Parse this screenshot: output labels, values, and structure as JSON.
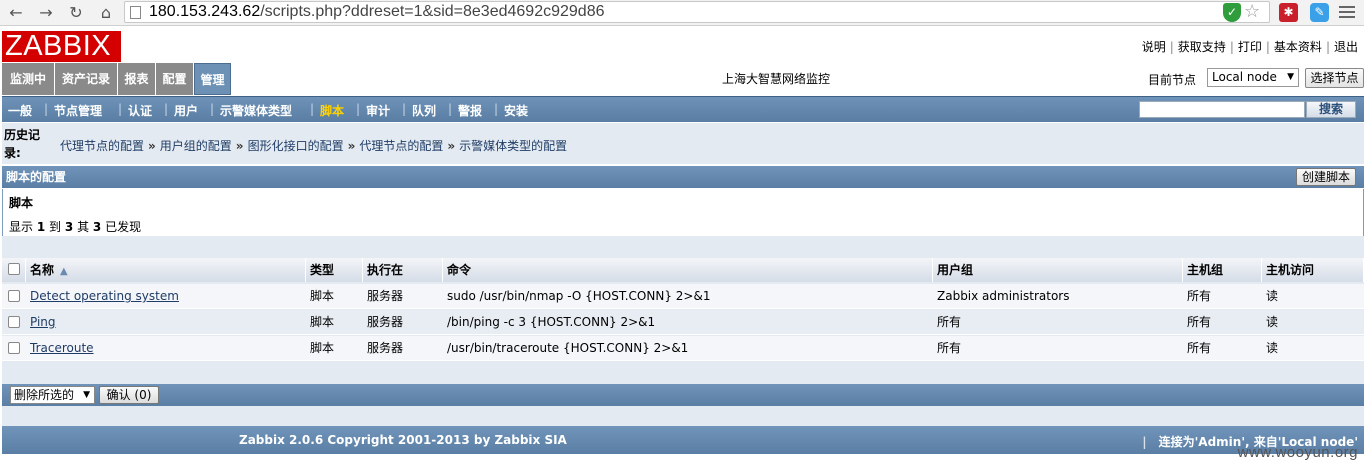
{
  "browser": {
    "url_host": "180.153.243.62",
    "url_path": "/scripts.php?ddreset=1&sid=8e3ed4692c929d86"
  },
  "header": {
    "logo": "ZABBIX",
    "links": [
      "说明",
      "获取支持",
      "打印",
      "基本资料",
      "退出"
    ]
  },
  "main_menu": {
    "tabs": [
      "监测中",
      "资产记录",
      "报表",
      "配置",
      "管理"
    ],
    "active": "管理",
    "site_title": "上海大智慧网络监控",
    "node_label": "目前节点",
    "node_value": "Local node",
    "select_node_button": "选择节点"
  },
  "sub_menu": {
    "items": [
      "一般",
      "节点管理",
      "认证",
      "用户",
      "示警媒体类型",
      "脚本",
      "审计",
      "队列",
      "警报",
      "安装"
    ],
    "active": "脚本",
    "search_button": "搜索"
  },
  "history": {
    "label": "历史记录:",
    "links": [
      "代理节点的配置",
      "用户组的配置",
      "图形化接口的配置",
      "代理节点的配置",
      "示警媒体类型的配置"
    ]
  },
  "section": {
    "title": "脚本的配置",
    "create_button": "创建脚本",
    "panel_title": "脚本",
    "count_prefix": "显示",
    "count_from": "1",
    "count_to_word": "到",
    "count_to": "3",
    "count_of_word": "其",
    "count_total": "3",
    "count_suffix": "已发现"
  },
  "table": {
    "columns": [
      "名称",
      "类型",
      "执行在",
      "命令",
      "用户组",
      "主机组",
      "主机访问"
    ],
    "rows": [
      {
        "name": "Detect operating system",
        "type": "脚本",
        "exec": "服务器",
        "command": "sudo /usr/bin/nmap -O {HOST.CONN} 2>&1",
        "usergroup": "Zabbix administrators",
        "hostgroup": "所有",
        "access": "读"
      },
      {
        "name": "Ping",
        "type": "脚本",
        "exec": "服务器",
        "command": "/bin/ping -c 3 {HOST.CONN} 2>&1",
        "usergroup": "所有",
        "hostgroup": "所有",
        "access": "读"
      },
      {
        "name": "Traceroute",
        "type": "脚本",
        "exec": "服务器",
        "command": "/usr/bin/traceroute {HOST.CONN} 2>&1",
        "usergroup": "所有",
        "hostgroup": "所有",
        "access": "读"
      }
    ]
  },
  "actions": {
    "mass_select": "删除所选的",
    "confirm_button": "确认 (0)"
  },
  "footer": {
    "copyright": "Zabbix 2.0.6 Copyright 2001-2013 by Zabbix SIA",
    "connected": "连接为'Admin', 来自'Local node'"
  },
  "watermark": "www.wooyun.org"
}
